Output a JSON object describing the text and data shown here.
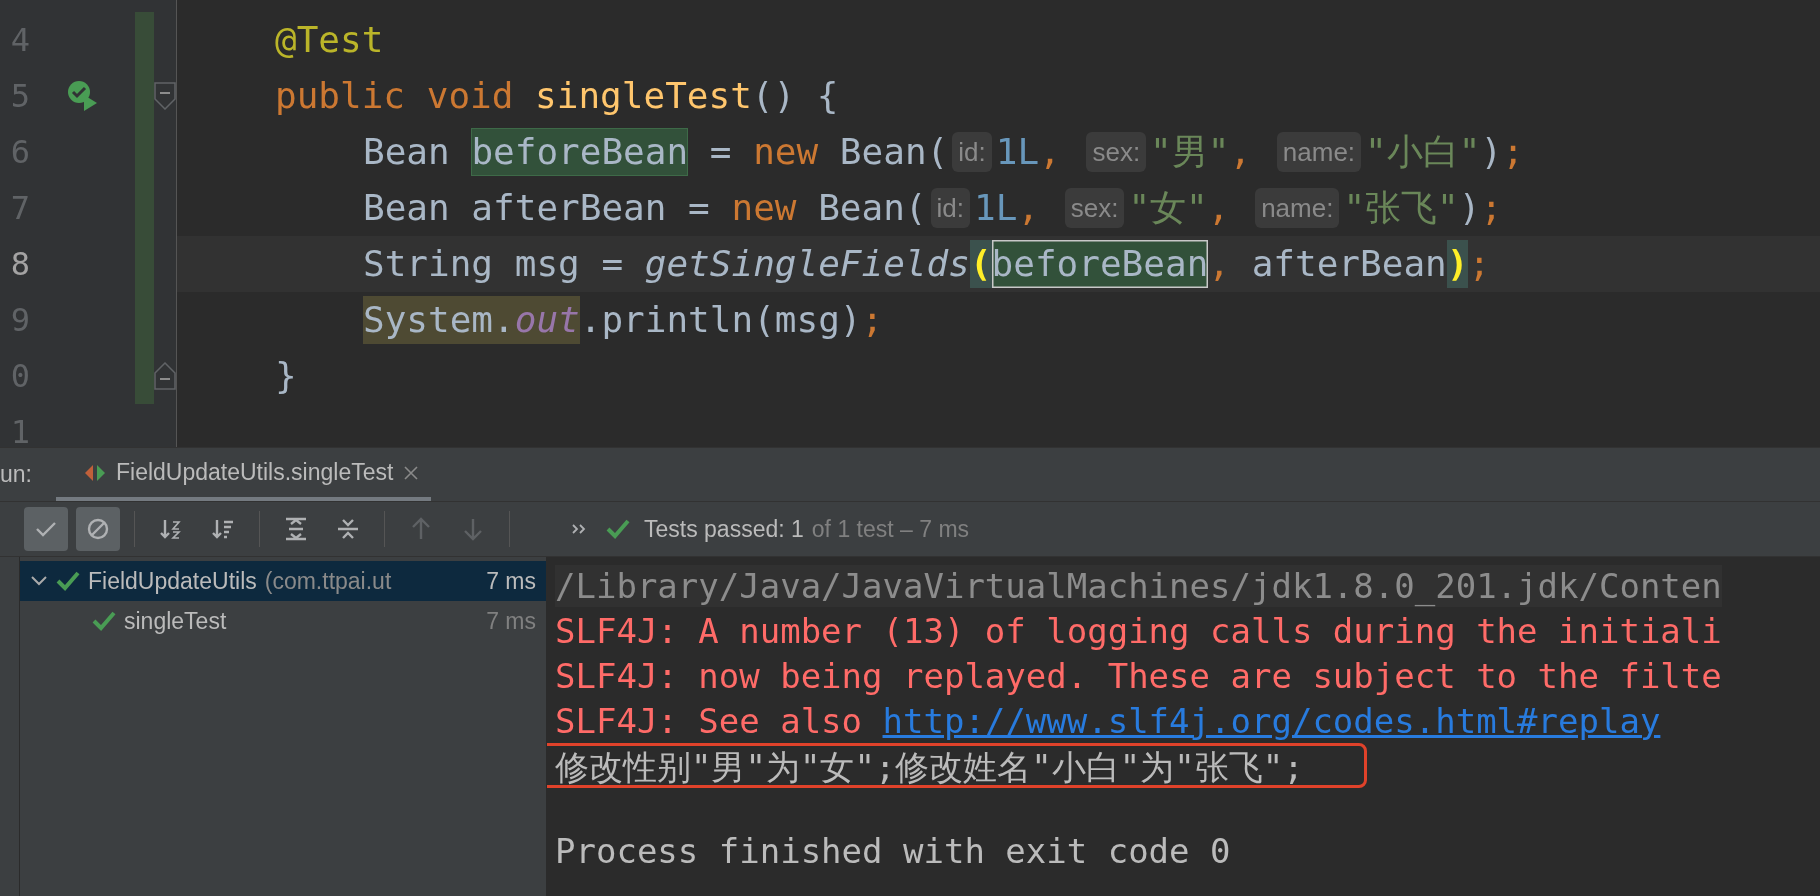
{
  "editor": {
    "lines": [
      {
        "number": "4",
        "current": false,
        "changed": true,
        "run_icon": false,
        "fold_open": false,
        "fold_close": false,
        "tokens": [
          {
            "text": "@Test",
            "kind": "annotation"
          }
        ]
      },
      {
        "number": "5",
        "current": false,
        "changed": true,
        "run_icon": true,
        "fold_open": true,
        "fold_close": false,
        "tokens": [
          {
            "text": "public",
            "kind": "keyword"
          },
          {
            "text": " void",
            "kind": "keyword"
          },
          {
            "text": " singleTest",
            "kind": "method-decl"
          },
          {
            "text": "() {",
            "kind": "plain"
          }
        ],
        "children": [
          {
            "number": "6",
            "current": false,
            "changed": true,
            "run_icon": false,
            "fold_open": false,
            "fold_close": false,
            "tokens": [
              {
                "text": "Bean ",
                "kind": "plain"
              },
              {
                "text": "beforeBean",
                "kind": "usage-write"
              },
              {
                "text": " = ",
                "kind": "plain"
              },
              {
                "text": "new",
                "kind": "keyword"
              },
              {
                "text": " Bean(",
                "kind": "plain"
              },
              {
                "text": "id:",
                "kind": "hint"
              },
              {
                "text": "1L",
                "kind": "number"
              },
              {
                "text": ", ",
                "kind": "punct"
              },
              {
                "text": "sex:",
                "kind": "hint"
              },
              {
                "text": "\"男\"",
                "kind": "string"
              },
              {
                "text": ", ",
                "kind": "punct"
              },
              {
                "text": "name:",
                "kind": "hint"
              },
              {
                "text": "\"小白\"",
                "kind": "string"
              },
              {
                "text": ")",
                "kind": "plain"
              },
              {
                "text": ";",
                "kind": "punct"
              }
            ]
          },
          {
            "number": "7",
            "current": false,
            "changed": true,
            "run_icon": false,
            "fold_open": false,
            "fold_close": false,
            "tokens": [
              {
                "text": "Bean afterBean = ",
                "kind": "plain"
              },
              {
                "text": "new",
                "kind": "keyword"
              },
              {
                "text": " Bean(",
                "kind": "plain"
              },
              {
                "text": "id:",
                "kind": "hint"
              },
              {
                "text": "1L",
                "kind": "number"
              },
              {
                "text": ", ",
                "kind": "punct"
              },
              {
                "text": "sex:",
                "kind": "hint"
              },
              {
                "text": "\"女\"",
                "kind": "string"
              },
              {
                "text": ", ",
                "kind": "punct"
              },
              {
                "text": "name:",
                "kind": "hint"
              },
              {
                "text": "\"张飞\"",
                "kind": "string"
              },
              {
                "text": ")",
                "kind": "plain"
              },
              {
                "text": ";",
                "kind": "punct"
              }
            ]
          },
          {
            "number": "8",
            "current": true,
            "changed": true,
            "run_icon": false,
            "fold_open": false,
            "fold_close": false,
            "tokens": [
              {
                "text": "String msg = ",
                "kind": "plain"
              },
              {
                "text": "getSingleFields",
                "kind": "static-call"
              },
              {
                "text": "(",
                "kind": "brace-match"
              },
              {
                "text": "beforeBean",
                "kind": "usage-caret"
              },
              {
                "text": ",",
                "kind": "punct"
              },
              {
                "text": " afterBean",
                "kind": "plain"
              },
              {
                "text": ")",
                "kind": "brace-match"
              },
              {
                "text": ";",
                "kind": "punct"
              }
            ]
          },
          {
            "number": "9",
            "current": false,
            "changed": true,
            "run_icon": false,
            "fold_open": false,
            "fold_close": false,
            "tokens": [
              {
                "text": "System.",
                "kind": "usage-read"
              },
              {
                "text": "out",
                "kind": "usage-read-field"
              },
              {
                "text": ".println(msg)",
                "kind": "plain"
              },
              {
                "text": ";",
                "kind": "punct"
              }
            ]
          }
        ]
      },
      {
        "number": "0",
        "current": false,
        "changed": true,
        "run_icon": false,
        "fold_open": false,
        "fold_close": true,
        "tokens": [
          {
            "text": "}",
            "kind": "plain"
          }
        ]
      },
      {
        "number": "1",
        "current": false,
        "changed": false,
        "run_icon": false,
        "fold_open": false,
        "fold_close": false
      }
    ]
  },
  "run_panel": {
    "label": "un:",
    "tabs": [
      {
        "title": "FieldUpdateUtils.singleTest",
        "selected": true
      }
    ],
    "toolbar": [
      {
        "buttons": [
          {
            "kind": "check",
            "on": true,
            "disabled": false
          },
          {
            "kind": "stop",
            "on": true,
            "disabled": false
          }
        ]
      },
      {
        "buttons": [
          {
            "kind": "sort-alpha",
            "on": false,
            "disabled": false
          },
          {
            "kind": "sort-duration",
            "on": false,
            "disabled": false
          }
        ]
      },
      {
        "buttons": [
          {
            "kind": "expand",
            "on": false,
            "disabled": false
          },
          {
            "kind": "collapse",
            "on": false,
            "disabled": false
          }
        ]
      },
      {
        "buttons": [
          {
            "kind": "up",
            "on": false,
            "disabled": true
          },
          {
            "kind": "down",
            "on": false,
            "disabled": true
          }
        ]
      },
      {
        "buttons": [
          {
            "kind": "more",
            "on": false,
            "disabled": false
          }
        ]
      }
    ],
    "status": {
      "passed": "Tests passed: 1",
      "detail": "of 1 test – 7 ms"
    },
    "tree": [
      {
        "name": "FieldUpdateUtils",
        "package": "(com.ttpai.ut",
        "time": "7 ms",
        "selected": true,
        "expanded": true,
        "children": [
          {
            "name": "singleTest",
            "time": "7 ms",
            "selected": false
          }
        ]
      }
    ],
    "console": [
      {
        "kind": "system",
        "text": "/Library/Java/JavaVirtualMachines/jdk1.8.0_201.jdk/Conten",
        "framed": false
      },
      {
        "kind": "error",
        "text": "SLF4J: A number (13) of logging calls during the initiali",
        "framed": false
      },
      {
        "kind": "error",
        "text": "SLF4J: now being replayed. These are subject to the filte",
        "framed": false
      },
      {
        "kind": "error",
        "text": "SLF4J: See also ",
        "link": "http://www.slf4j.org/codes.html#replay",
        "framed": false
      },
      {
        "kind": "output",
        "text": "修改性别\"男\"为\"女\";修改姓名\"小白\"为\"张飞\";",
        "framed": true
      },
      {
        "kind": "exit",
        "text": "Process finished with exit code 0",
        "framed": false
      }
    ]
  }
}
